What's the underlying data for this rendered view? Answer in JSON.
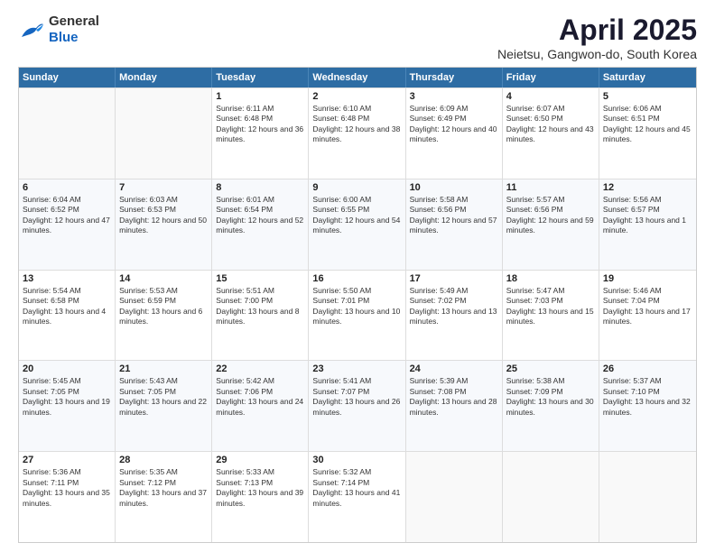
{
  "header": {
    "logo_general": "General",
    "logo_blue": "Blue",
    "month_title": "April 2025",
    "location": "Neietsu, Gangwon-do, South Korea"
  },
  "days_of_week": [
    "Sunday",
    "Monday",
    "Tuesday",
    "Wednesday",
    "Thursday",
    "Friday",
    "Saturday"
  ],
  "weeks": [
    [
      {
        "day": "",
        "sunrise": "",
        "sunset": "",
        "daylight": ""
      },
      {
        "day": "",
        "sunrise": "",
        "sunset": "",
        "daylight": ""
      },
      {
        "day": "1",
        "sunrise": "Sunrise: 6:11 AM",
        "sunset": "Sunset: 6:48 PM",
        "daylight": "Daylight: 12 hours and 36 minutes."
      },
      {
        "day": "2",
        "sunrise": "Sunrise: 6:10 AM",
        "sunset": "Sunset: 6:48 PM",
        "daylight": "Daylight: 12 hours and 38 minutes."
      },
      {
        "day": "3",
        "sunrise": "Sunrise: 6:09 AM",
        "sunset": "Sunset: 6:49 PM",
        "daylight": "Daylight: 12 hours and 40 minutes."
      },
      {
        "day": "4",
        "sunrise": "Sunrise: 6:07 AM",
        "sunset": "Sunset: 6:50 PM",
        "daylight": "Daylight: 12 hours and 43 minutes."
      },
      {
        "day": "5",
        "sunrise": "Sunrise: 6:06 AM",
        "sunset": "Sunset: 6:51 PM",
        "daylight": "Daylight: 12 hours and 45 minutes."
      }
    ],
    [
      {
        "day": "6",
        "sunrise": "Sunrise: 6:04 AM",
        "sunset": "Sunset: 6:52 PM",
        "daylight": "Daylight: 12 hours and 47 minutes."
      },
      {
        "day": "7",
        "sunrise": "Sunrise: 6:03 AM",
        "sunset": "Sunset: 6:53 PM",
        "daylight": "Daylight: 12 hours and 50 minutes."
      },
      {
        "day": "8",
        "sunrise": "Sunrise: 6:01 AM",
        "sunset": "Sunset: 6:54 PM",
        "daylight": "Daylight: 12 hours and 52 minutes."
      },
      {
        "day": "9",
        "sunrise": "Sunrise: 6:00 AM",
        "sunset": "Sunset: 6:55 PM",
        "daylight": "Daylight: 12 hours and 54 minutes."
      },
      {
        "day": "10",
        "sunrise": "Sunrise: 5:58 AM",
        "sunset": "Sunset: 6:56 PM",
        "daylight": "Daylight: 12 hours and 57 minutes."
      },
      {
        "day": "11",
        "sunrise": "Sunrise: 5:57 AM",
        "sunset": "Sunset: 6:56 PM",
        "daylight": "Daylight: 12 hours and 59 minutes."
      },
      {
        "day": "12",
        "sunrise": "Sunrise: 5:56 AM",
        "sunset": "Sunset: 6:57 PM",
        "daylight": "Daylight: 13 hours and 1 minute."
      }
    ],
    [
      {
        "day": "13",
        "sunrise": "Sunrise: 5:54 AM",
        "sunset": "Sunset: 6:58 PM",
        "daylight": "Daylight: 13 hours and 4 minutes."
      },
      {
        "day": "14",
        "sunrise": "Sunrise: 5:53 AM",
        "sunset": "Sunset: 6:59 PM",
        "daylight": "Daylight: 13 hours and 6 minutes."
      },
      {
        "day": "15",
        "sunrise": "Sunrise: 5:51 AM",
        "sunset": "Sunset: 7:00 PM",
        "daylight": "Daylight: 13 hours and 8 minutes."
      },
      {
        "day": "16",
        "sunrise": "Sunrise: 5:50 AM",
        "sunset": "Sunset: 7:01 PM",
        "daylight": "Daylight: 13 hours and 10 minutes."
      },
      {
        "day": "17",
        "sunrise": "Sunrise: 5:49 AM",
        "sunset": "Sunset: 7:02 PM",
        "daylight": "Daylight: 13 hours and 13 minutes."
      },
      {
        "day": "18",
        "sunrise": "Sunrise: 5:47 AM",
        "sunset": "Sunset: 7:03 PM",
        "daylight": "Daylight: 13 hours and 15 minutes."
      },
      {
        "day": "19",
        "sunrise": "Sunrise: 5:46 AM",
        "sunset": "Sunset: 7:04 PM",
        "daylight": "Daylight: 13 hours and 17 minutes."
      }
    ],
    [
      {
        "day": "20",
        "sunrise": "Sunrise: 5:45 AM",
        "sunset": "Sunset: 7:05 PM",
        "daylight": "Daylight: 13 hours and 19 minutes."
      },
      {
        "day": "21",
        "sunrise": "Sunrise: 5:43 AM",
        "sunset": "Sunset: 7:05 PM",
        "daylight": "Daylight: 13 hours and 22 minutes."
      },
      {
        "day": "22",
        "sunrise": "Sunrise: 5:42 AM",
        "sunset": "Sunset: 7:06 PM",
        "daylight": "Daylight: 13 hours and 24 minutes."
      },
      {
        "day": "23",
        "sunrise": "Sunrise: 5:41 AM",
        "sunset": "Sunset: 7:07 PM",
        "daylight": "Daylight: 13 hours and 26 minutes."
      },
      {
        "day": "24",
        "sunrise": "Sunrise: 5:39 AM",
        "sunset": "Sunset: 7:08 PM",
        "daylight": "Daylight: 13 hours and 28 minutes."
      },
      {
        "day": "25",
        "sunrise": "Sunrise: 5:38 AM",
        "sunset": "Sunset: 7:09 PM",
        "daylight": "Daylight: 13 hours and 30 minutes."
      },
      {
        "day": "26",
        "sunrise": "Sunrise: 5:37 AM",
        "sunset": "Sunset: 7:10 PM",
        "daylight": "Daylight: 13 hours and 32 minutes."
      }
    ],
    [
      {
        "day": "27",
        "sunrise": "Sunrise: 5:36 AM",
        "sunset": "Sunset: 7:11 PM",
        "daylight": "Daylight: 13 hours and 35 minutes."
      },
      {
        "day": "28",
        "sunrise": "Sunrise: 5:35 AM",
        "sunset": "Sunset: 7:12 PM",
        "daylight": "Daylight: 13 hours and 37 minutes."
      },
      {
        "day": "29",
        "sunrise": "Sunrise: 5:33 AM",
        "sunset": "Sunset: 7:13 PM",
        "daylight": "Daylight: 13 hours and 39 minutes."
      },
      {
        "day": "30",
        "sunrise": "Sunrise: 5:32 AM",
        "sunset": "Sunset: 7:14 PM",
        "daylight": "Daylight: 13 hours and 41 minutes."
      },
      {
        "day": "",
        "sunrise": "",
        "sunset": "",
        "daylight": ""
      },
      {
        "day": "",
        "sunrise": "",
        "sunset": "",
        "daylight": ""
      },
      {
        "day": "",
        "sunrise": "",
        "sunset": "",
        "daylight": ""
      }
    ]
  ]
}
